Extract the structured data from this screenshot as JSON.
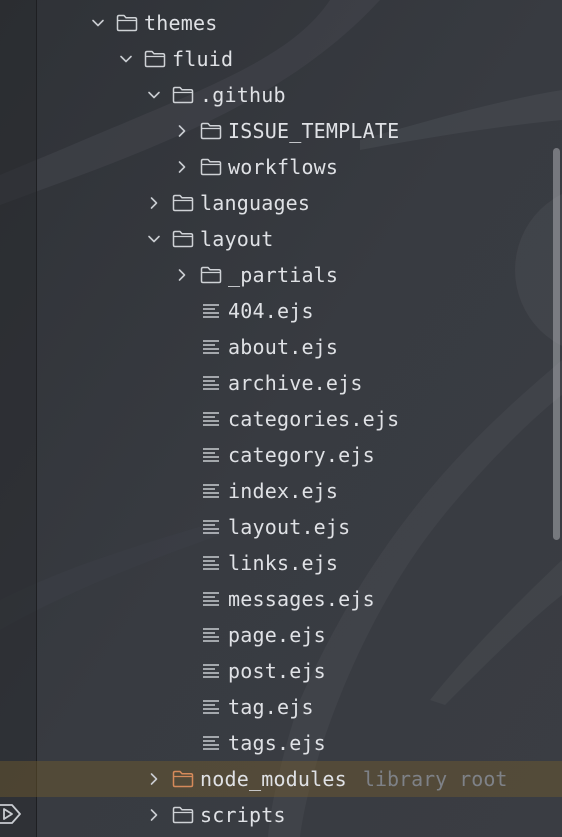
{
  "colors": {
    "background": "#34373d",
    "text": "#dfe1e5",
    "hint": "#7e8187",
    "highlight_row": "#5a4a2e",
    "folder_icon": "#cfd2d6",
    "excluded_folder_icon": "#d58a5a"
  },
  "tree": [
    {
      "label": "themes",
      "depth": 0,
      "chevron": "chevron-down-icon",
      "icon": "folder-icon",
      "hint": "",
      "highlight": false
    },
    {
      "label": "fluid",
      "depth": 1,
      "chevron": "chevron-down-icon",
      "icon": "folder-icon",
      "hint": "",
      "highlight": false
    },
    {
      "label": ".github",
      "depth": 2,
      "chevron": "chevron-down-icon",
      "icon": "folder-icon",
      "hint": "",
      "highlight": false
    },
    {
      "label": "ISSUE_TEMPLATE",
      "depth": 3,
      "chevron": "chevron-right-icon",
      "icon": "folder-icon",
      "hint": "",
      "highlight": false
    },
    {
      "label": "workflows",
      "depth": 3,
      "chevron": "chevron-right-icon",
      "icon": "folder-icon",
      "hint": "",
      "highlight": false
    },
    {
      "label": "languages",
      "depth": 2,
      "chevron": "chevron-right-icon",
      "icon": "folder-icon",
      "hint": "",
      "highlight": false
    },
    {
      "label": "layout",
      "depth": 2,
      "chevron": "chevron-down-icon",
      "icon": "folder-icon",
      "hint": "",
      "highlight": false
    },
    {
      "label": "_partials",
      "depth": 3,
      "chevron": "chevron-right-icon",
      "icon": "folder-icon",
      "hint": "",
      "highlight": false
    },
    {
      "label": "404.ejs",
      "depth": 3,
      "chevron": "",
      "icon": "text-file-icon",
      "hint": "",
      "highlight": false
    },
    {
      "label": "about.ejs",
      "depth": 3,
      "chevron": "",
      "icon": "text-file-icon",
      "hint": "",
      "highlight": false
    },
    {
      "label": "archive.ejs",
      "depth": 3,
      "chevron": "",
      "icon": "text-file-icon",
      "hint": "",
      "highlight": false
    },
    {
      "label": "categories.ejs",
      "depth": 3,
      "chevron": "",
      "icon": "text-file-icon",
      "hint": "",
      "highlight": false
    },
    {
      "label": "category.ejs",
      "depth": 3,
      "chevron": "",
      "icon": "text-file-icon",
      "hint": "",
      "highlight": false
    },
    {
      "label": "index.ejs",
      "depth": 3,
      "chevron": "",
      "icon": "text-file-icon",
      "hint": "",
      "highlight": false
    },
    {
      "label": "layout.ejs",
      "depth": 3,
      "chevron": "",
      "icon": "text-file-icon",
      "hint": "",
      "highlight": false
    },
    {
      "label": "links.ejs",
      "depth": 3,
      "chevron": "",
      "icon": "text-file-icon",
      "hint": "",
      "highlight": false
    },
    {
      "label": "messages.ejs",
      "depth": 3,
      "chevron": "",
      "icon": "text-file-icon",
      "hint": "",
      "highlight": false
    },
    {
      "label": "page.ejs",
      "depth": 3,
      "chevron": "",
      "icon": "text-file-icon",
      "hint": "",
      "highlight": false
    },
    {
      "label": "post.ejs",
      "depth": 3,
      "chevron": "",
      "icon": "text-file-icon",
      "hint": "",
      "highlight": false
    },
    {
      "label": "tag.ejs",
      "depth": 3,
      "chevron": "",
      "icon": "text-file-icon",
      "hint": "",
      "highlight": false
    },
    {
      "label": "tags.ejs",
      "depth": 3,
      "chevron": "",
      "icon": "text-file-icon",
      "hint": "",
      "highlight": false
    },
    {
      "label": "node_modules",
      "depth": 2,
      "chevron": "chevron-right-icon",
      "icon": "excluded-folder-icon",
      "hint": "library root",
      "highlight": true
    },
    {
      "label": "scripts",
      "depth": 2,
      "chevron": "chevron-right-icon",
      "icon": "folder-icon",
      "hint": "",
      "highlight": false
    }
  ],
  "corner_button": {
    "icon": "run-icon"
  }
}
